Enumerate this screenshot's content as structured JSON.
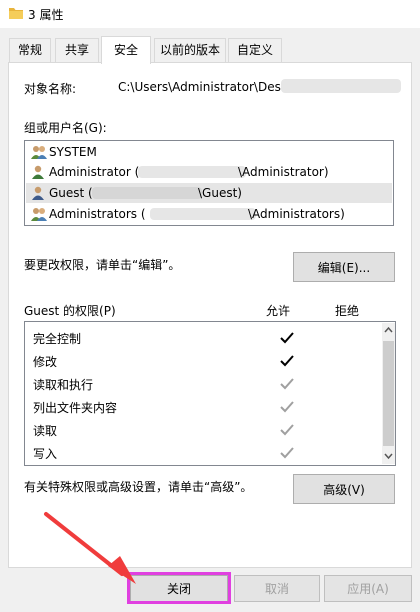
{
  "window": {
    "title": "3 属性"
  },
  "tabs": [
    "常规",
    "共享",
    "安全",
    "以前的版本",
    "自定义"
  ],
  "object": {
    "label": "对象名称:",
    "value": "C:\\Users\\Administrator\\Desl"
  },
  "group": {
    "label": "组或用户名(G):",
    "items": [
      {
        "name": "SYSTEM",
        "suffix": ""
      },
      {
        "name": "Administrator (",
        "suffix": "\\Administrator)"
      },
      {
        "name": "Guest (",
        "suffix": "\\Guest)"
      },
      {
        "name": "Administrators (",
        "suffix": "\\Administrators)"
      }
    ]
  },
  "edit": {
    "hint": "要更改权限，请单击“编辑”。",
    "button": "编辑(E)..."
  },
  "permissions": {
    "title": "Guest 的权限(P)",
    "allow_header": "允许",
    "deny_header": "拒绝",
    "rows": [
      {
        "name": "完全控制",
        "allow": "checked"
      },
      {
        "name": "修改",
        "allow": "checked"
      },
      {
        "name": "读取和执行",
        "allow": "inherited"
      },
      {
        "name": "列出文件夹内容",
        "allow": "inherited"
      },
      {
        "name": "读取",
        "allow": "inherited"
      },
      {
        "name": "写入",
        "allow": "inherited"
      }
    ]
  },
  "advanced": {
    "hint": "有关特殊权限或高级设置，请单击“高级”。",
    "button": "高级(V)"
  },
  "footer": {
    "close": "关闭",
    "cancel": "取消",
    "apply": "应用(A)"
  },
  "colors": {
    "highlight": "#e040e0",
    "arrow": "#f03c3c",
    "check_dark": "#000000",
    "check_grey": "#a0a0a0"
  }
}
